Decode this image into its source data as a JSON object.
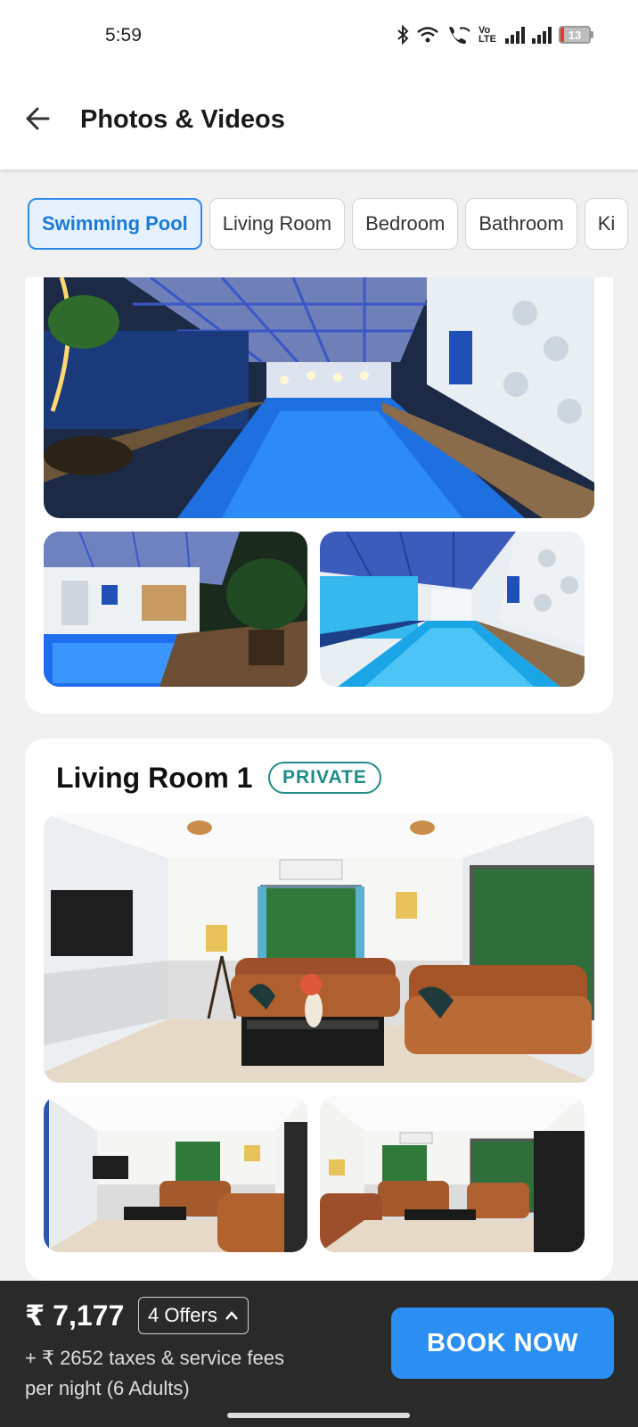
{
  "status_bar": {
    "time": "5:59",
    "volte_label": "Vo LTE",
    "battery_level": 13,
    "battery_text": "13",
    "battery_color": "#e53935"
  },
  "header": {
    "title": "Photos & Videos",
    "back_icon": "arrow-left-icon"
  },
  "tabs": [
    {
      "label": "Swimming Pool",
      "active": true
    },
    {
      "label": "Living Room",
      "active": false
    },
    {
      "label": "Bedroom",
      "active": false
    },
    {
      "label": "Bathroom",
      "active": false
    },
    {
      "label": "Ki",
      "active": false
    }
  ],
  "sections": {
    "living_room": {
      "title": "Living Room 1",
      "badge": "PRIVATE"
    }
  },
  "bottom_bar": {
    "price": "₹ 7,177",
    "offers_label": "4 Offers",
    "taxes": "+ ₹ 2652 taxes & service fees",
    "per_night": "per night (6 Adults)",
    "book_label": "BOOK NOW"
  },
  "colors": {
    "accent": "#2b8ef2",
    "badge": "#1f8c88",
    "pool_water": "#1e6fe0"
  }
}
